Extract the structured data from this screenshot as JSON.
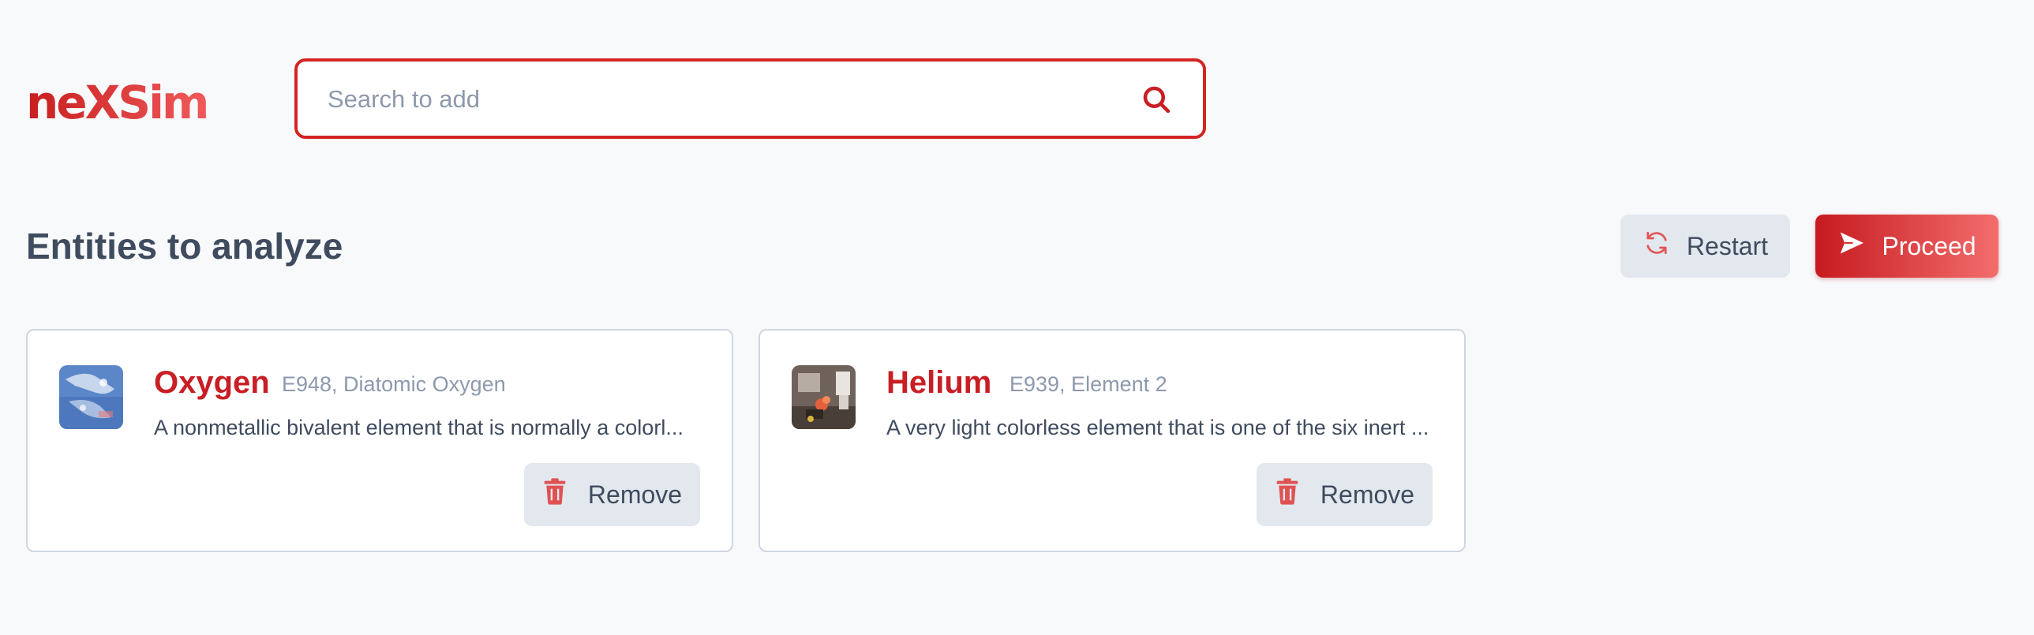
{
  "header": {
    "logo": "neXSim",
    "search": {
      "placeholder": "Search to add",
      "value": ""
    }
  },
  "section": {
    "title": "Entities to analyze",
    "restart_label": "Restart",
    "proceed_label": "Proceed"
  },
  "entities": [
    {
      "name": "Oxygen",
      "meta": "E948, Diatomic Oxygen",
      "description": "A nonmetallic bivalent element that is normally a colorl...",
      "remove_label": "Remove"
    },
    {
      "name": "Helium",
      "meta": "E939, Element 2",
      "description": "A very light colorless element that is one of the six inert ...",
      "remove_label": "Remove"
    }
  ],
  "colors": {
    "accent": "#c81e24",
    "accent_light": "#f36d6d",
    "background": "#f8f9fb",
    "text": "#3f4b5e",
    "muted": "#8d99ac",
    "button_gray": "#e3e8ef"
  },
  "icons": {
    "search": "search-icon",
    "restart": "refresh-icon",
    "proceed": "send-icon",
    "remove": "trash-icon"
  }
}
